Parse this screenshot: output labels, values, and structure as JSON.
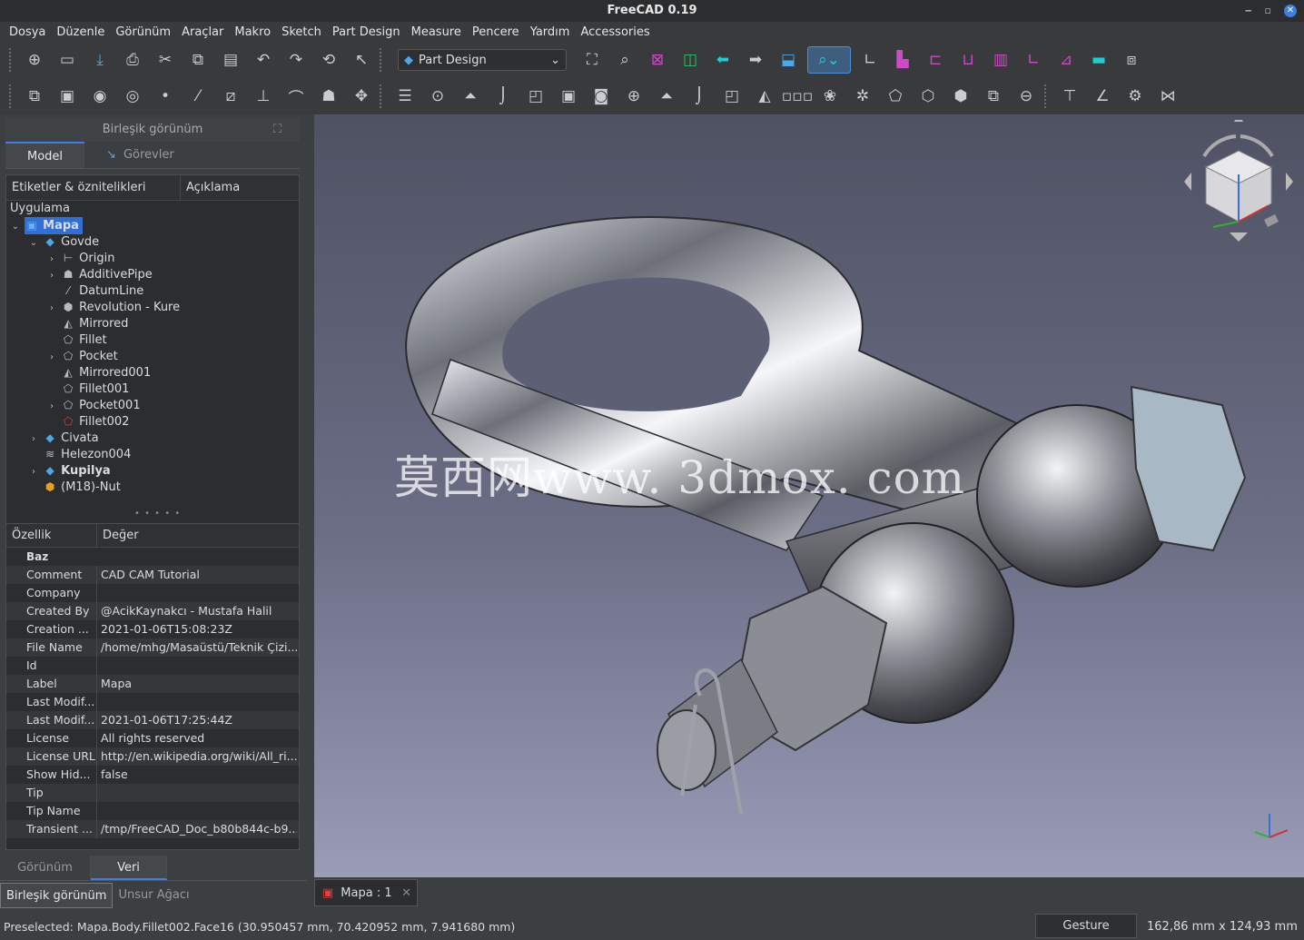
{
  "window": {
    "title": "FreeCAD 0.19",
    "minimize": "‒",
    "maximize": "▫",
    "close": "✕"
  },
  "menu": [
    "Dosya",
    "Düzenle",
    "Görünüm",
    "Araçlar",
    "Makro",
    "Sketch",
    "Part Design",
    "Measure",
    "Pencere",
    "Yardım",
    "Accessories"
  ],
  "toolbar": {
    "workbench": "Part Design"
  },
  "combo": {
    "title": "Birleşik görünüm",
    "tabs": [
      "Model",
      "Görevler"
    ],
    "tree_headers": [
      "Etiketler & öznitelikleri",
      "Açıklama"
    ],
    "root": "Uygulama",
    "items": [
      {
        "label": "Mapa"
      },
      {
        "label": "Govde"
      },
      {
        "label": "Origin"
      },
      {
        "label": "AdditivePipe"
      },
      {
        "label": "DatumLine"
      },
      {
        "label": "Revolution - Kure"
      },
      {
        "label": "Mirrored"
      },
      {
        "label": "Fillet"
      },
      {
        "label": "Pocket"
      },
      {
        "label": "Mirrored001"
      },
      {
        "label": "Fillet001"
      },
      {
        "label": "Pocket001"
      },
      {
        "label": "Fillet002"
      },
      {
        "label": "Civata"
      },
      {
        "label": "Helezon004"
      },
      {
        "label": "Kupilya"
      },
      {
        "label": "(M18)-Nut"
      }
    ],
    "prop_headers": [
      "Özellik",
      "Değer"
    ],
    "prop_group": "Baz",
    "props": [
      {
        "k": "Comment",
        "v": "CAD CAM Tutorial"
      },
      {
        "k": "Company",
        "v": ""
      },
      {
        "k": "Created By",
        "v": "@AcikKaynakcı - Mustafa Halil"
      },
      {
        "k": "Creation ...",
        "v": "2021-01-06T15:08:23Z"
      },
      {
        "k": "File Name",
        "v": "/home/mhg/Masaüstü/Teknik Çizi..."
      },
      {
        "k": "Id",
        "v": ""
      },
      {
        "k": "Label",
        "v": "Mapa"
      },
      {
        "k": "Last Modif...",
        "v": ""
      },
      {
        "k": "Last Modif...",
        "v": "2021-01-06T17:25:44Z"
      },
      {
        "k": "License",
        "v": "All rights reserved"
      },
      {
        "k": "License URL",
        "v": "http://en.wikipedia.org/wiki/All_ri..."
      },
      {
        "k": "Show Hid...",
        "v": "false"
      },
      {
        "k": "Tip",
        "v": ""
      },
      {
        "k": "Tip Name",
        "v": ""
      },
      {
        "k": "Transient ...",
        "v": "/tmp/FreeCAD_Doc_b80b844c-b9..."
      }
    ],
    "view_tabs": [
      "Görünüm",
      "Veri"
    ],
    "panel_tabs": [
      "Birleşik görünüm",
      "Unsur Ağacı"
    ]
  },
  "viewport": {
    "watermark": "莫西网www. 3dmox. com"
  },
  "doc_tab": {
    "label": "Mapa : 1"
  },
  "status": {
    "preselected": "Preselected: Mapa.Body.Fillet002.Face16 (30.950457 mm, 70.420952 mm, 7.941680 mm)",
    "nav_style": "Gesture",
    "dimensions": "162,86 mm x 124,93 mm"
  },
  "colors": {
    "accent": "#3d7ee0",
    "selection": "#2f6fd6",
    "background": "#3c3f41"
  }
}
